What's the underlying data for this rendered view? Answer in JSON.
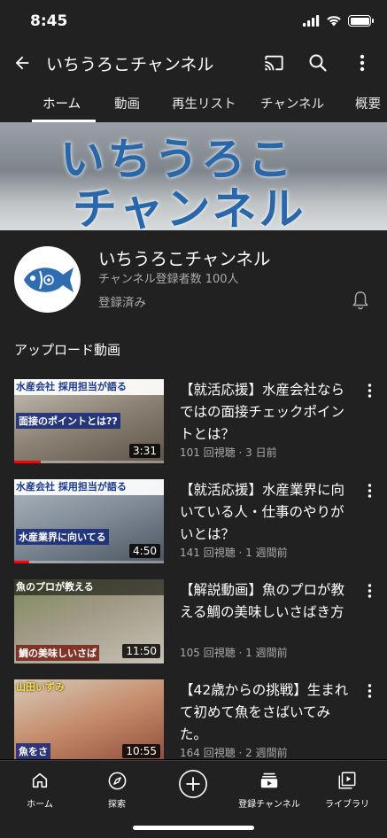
{
  "status_bar": {
    "time": "8:45"
  },
  "app_bar": {
    "title": "いちうろこチャンネル",
    "icons": [
      "back-arrow-icon",
      "cast-icon",
      "search-icon",
      "more-vert-icon"
    ]
  },
  "tabs": [
    {
      "label": "ホーム",
      "active": true
    },
    {
      "label": "動画",
      "active": false
    },
    {
      "label": "再生リスト",
      "active": false
    },
    {
      "label": "チャンネル",
      "active": false
    },
    {
      "label": "概要",
      "active": false
    }
  ],
  "banner": {
    "line1": "いちうろこ",
    "line2": "チャンネル"
  },
  "channel": {
    "name": "いちうろこチャンネル",
    "subscribers": "チャンネル登録者数 100人",
    "subscribed_label": "登録済み",
    "avatar_icon": "fish-logo-icon",
    "brand_color": "#2f6db3"
  },
  "uploads": {
    "title": "アップロード動画",
    "videos": [
      {
        "title": "【就活応援】水産会社ならではの面接チェックポイントとは？",
        "meta": "101 回視聴 · 3 日前",
        "duration": "3:31",
        "thumb_top": "水産会社 採用担当が語る",
        "thumb_caption": "面接のポイントとは??",
        "progress": 0.18
      },
      {
        "title": "【就活応援】水産業界に向いている人・仕事のやりがいとは？",
        "meta": "141 回視聴 · 1 週間前",
        "duration": "4:50",
        "thumb_top": "水産会社 採用担当が語る",
        "thumb_caption": "水産業界に向いてる",
        "progress": 0.1
      },
      {
        "title": "【解説動画】魚のプロが教える鯛の美味しいさばき方",
        "meta": "105 回視聴 · 1 週間前",
        "duration": "11:50",
        "thumb_top": "魚のプロが教える",
        "thumb_caption": "鯛の美味しいさば",
        "progress": 0
      },
      {
        "title": "【42歳からの挑戦】生まれて初めて魚をさばいてみた。",
        "meta": "164 回視聴 · 2 週間前",
        "duration": "10:55",
        "thumb_top": "山田いずみ",
        "thumb_caption": "魚をさ",
        "progress": 0
      }
    ]
  },
  "bottom_nav": [
    {
      "label": "ホーム",
      "icon": "home-icon"
    },
    {
      "label": "探索",
      "icon": "explore-icon"
    },
    {
      "label": "",
      "icon": "create-plus-icon"
    },
    {
      "label": "登録チャンネル",
      "icon": "subscriptions-icon"
    },
    {
      "label": "ライブラリ",
      "icon": "library-icon"
    }
  ]
}
